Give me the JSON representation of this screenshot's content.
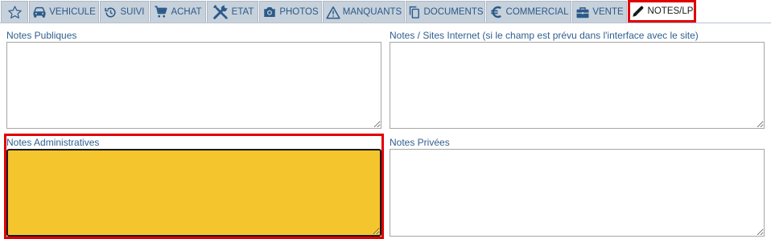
{
  "tabs": [
    {
      "id": "favori",
      "label": "",
      "icon": "star-outline-icon"
    },
    {
      "id": "vehicule",
      "label": "VEHICULE",
      "icon": "car-icon"
    },
    {
      "id": "suivi",
      "label": "SUIVI",
      "icon": "history-icon"
    },
    {
      "id": "achat",
      "label": "ACHAT",
      "icon": "cart-icon"
    },
    {
      "id": "etat",
      "label": "ETAT",
      "icon": "tools-icon"
    },
    {
      "id": "photos",
      "label": "PHOTOS",
      "icon": "camera-icon"
    },
    {
      "id": "manquants",
      "label": "MANQUANTS",
      "icon": "warning-icon"
    },
    {
      "id": "documents",
      "label": "DOCUMENTS",
      "icon": "copy-icon"
    },
    {
      "id": "commercial",
      "label": "COMMERCIAL",
      "icon": "euro-icon"
    },
    {
      "id": "vente",
      "label": "VENTE",
      "icon": "briefcase-icon"
    },
    {
      "id": "notes",
      "label": "NOTES/LP",
      "icon": "pencil-icon",
      "active": true
    }
  ],
  "fields": {
    "notes_publiques": {
      "label": "Notes Publiques",
      "value": ""
    },
    "notes_sites": {
      "label": "Notes / Sites Internet (si le champ est prévu dans l'interface avec le site)",
      "value": ""
    },
    "notes_administratives": {
      "label": "Notes Administratives",
      "value": "",
      "fill_color": "#f5c52d"
    },
    "notes_privees": {
      "label": "Notes Privées",
      "value": ""
    }
  },
  "colors": {
    "tab_background": "#c7d1db",
    "tab_text": "#2b5a8a",
    "highlight": "#e00000",
    "label_text": "#2f5f8f"
  }
}
